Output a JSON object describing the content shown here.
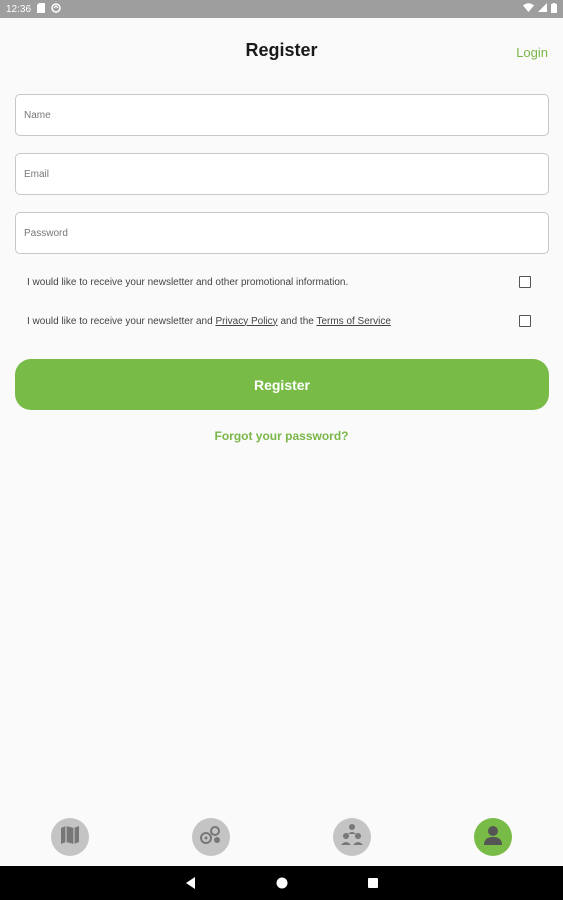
{
  "status_bar": {
    "time": "12:36"
  },
  "header": {
    "title": "Register",
    "login_label": "Login"
  },
  "form": {
    "name_placeholder": "Name",
    "email_placeholder": "Email",
    "password_placeholder": "Password",
    "newsletter_text": "I would like to receive your newsletter and other promotional information.",
    "terms_prefix": "I would like to receive your newsletter and ",
    "privacy_link": "Privacy Policy",
    "terms_middle": " and the ",
    "terms_link": "Terms of Service",
    "register_label": "Register",
    "forgot_label": "Forgot your password?"
  },
  "bottom_nav": {
    "items": [
      {
        "icon": "map-icon",
        "active": false
      },
      {
        "icon": "places-icon",
        "active": false
      },
      {
        "icon": "group-icon",
        "active": false
      },
      {
        "icon": "profile-icon",
        "active": true
      }
    ]
  },
  "colors": {
    "accent": "#78bb46",
    "status_bar": "#9e9e9e",
    "nav_inactive": "#c4c4c4"
  }
}
